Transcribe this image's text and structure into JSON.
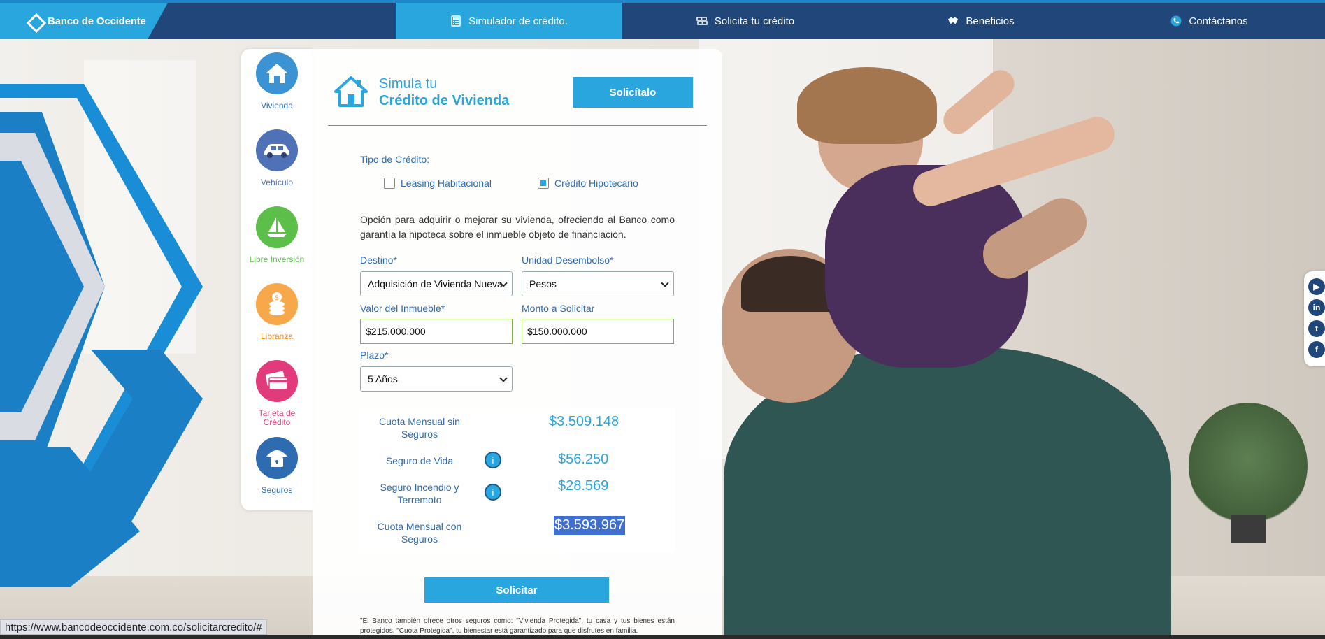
{
  "brand": {
    "name": "Banco de Occidente"
  },
  "nav": {
    "items": [
      {
        "label": "Simulador de crédito.",
        "icon": "calculator-icon",
        "active": true
      },
      {
        "label": "Solicita tu crédito",
        "icon": "money-icon",
        "active": false
      },
      {
        "label": "Beneficios",
        "icon": "handshake-icon",
        "active": false
      },
      {
        "label": "Contáctanos",
        "icon": "phone-icon",
        "active": false
      }
    ]
  },
  "sidebar": {
    "items": [
      {
        "label": "Vivienda",
        "icon": "house-icon",
        "color": "#3c93d3"
      },
      {
        "label": "Vehículo",
        "icon": "car-icon",
        "color": "#4f72b6"
      },
      {
        "label": "Libre Inversión",
        "icon": "sailboat-icon",
        "color": "#5cbf4a"
      },
      {
        "label": "Libranza",
        "icon": "coins-icon",
        "color": "#f7a84a"
      },
      {
        "label": "Tarjeta de Crédito",
        "icon": "credit-card-icon",
        "color": "#e23b7c"
      },
      {
        "label": "Seguros",
        "icon": "umbrella-lock-icon",
        "color": "#2f6bb0"
      }
    ]
  },
  "header": {
    "title_line1": "Simula tu",
    "title_line2": "Crédito de Vivienda",
    "apply_button": "Solicítalo"
  },
  "form": {
    "credit_type_label": "Tipo de Crédito:",
    "options": [
      {
        "label": "Leasing Habitacional",
        "checked": false
      },
      {
        "label": "Crédito Hipotecario",
        "checked": true
      }
    ],
    "description": "Opción para adquirir o mejorar su vivienda, ofreciendo al Banco como garantía la hipoteca sobre el inmueble objeto de financiación.",
    "destino_label": "Destino*",
    "destino_value": "Adquisición de Vivienda Nueva",
    "unidad_label": "Unidad Desembolso*",
    "unidad_value": "Pesos",
    "valor_label": "Valor del Inmueble*",
    "valor_value": "$215.000.000",
    "monto_label": "Monto a Solicitar",
    "monto_value": "$150.000.000",
    "plazo_label": "Plazo*",
    "plazo_value": "5 Años"
  },
  "results": {
    "rows": [
      {
        "label": "Cuota Mensual sin Seguros",
        "value": "$3.509.148"
      },
      {
        "label": "Seguro de Vida",
        "value": "$56.250"
      },
      {
        "label": "Seguro Incendio y Terremoto",
        "value": "$28.569"
      },
      {
        "label": "Cuota Mensual con Seguros",
        "value": "$3.593.967"
      }
    ],
    "info_glyph": "i"
  },
  "actions": {
    "submit": "Solicitar"
  },
  "disclaimer": "\"El Banco también ofrece otros seguros como: \"Vivienda Protegida\", tu casa y tus bienes están protegidos, \"Cuota Protegida\", tu bienestar está garantizado para que disfrutes en familia.",
  "social": [
    {
      "name": "youtube-icon",
      "glyph": "▶"
    },
    {
      "name": "linkedin-icon",
      "glyph": "in"
    },
    {
      "name": "twitter-icon",
      "glyph": "t"
    },
    {
      "name": "facebook-icon",
      "glyph": "f"
    }
  ],
  "status_url": "https://www.bancodeoccidente.com.co/solicitarcredito/#"
}
